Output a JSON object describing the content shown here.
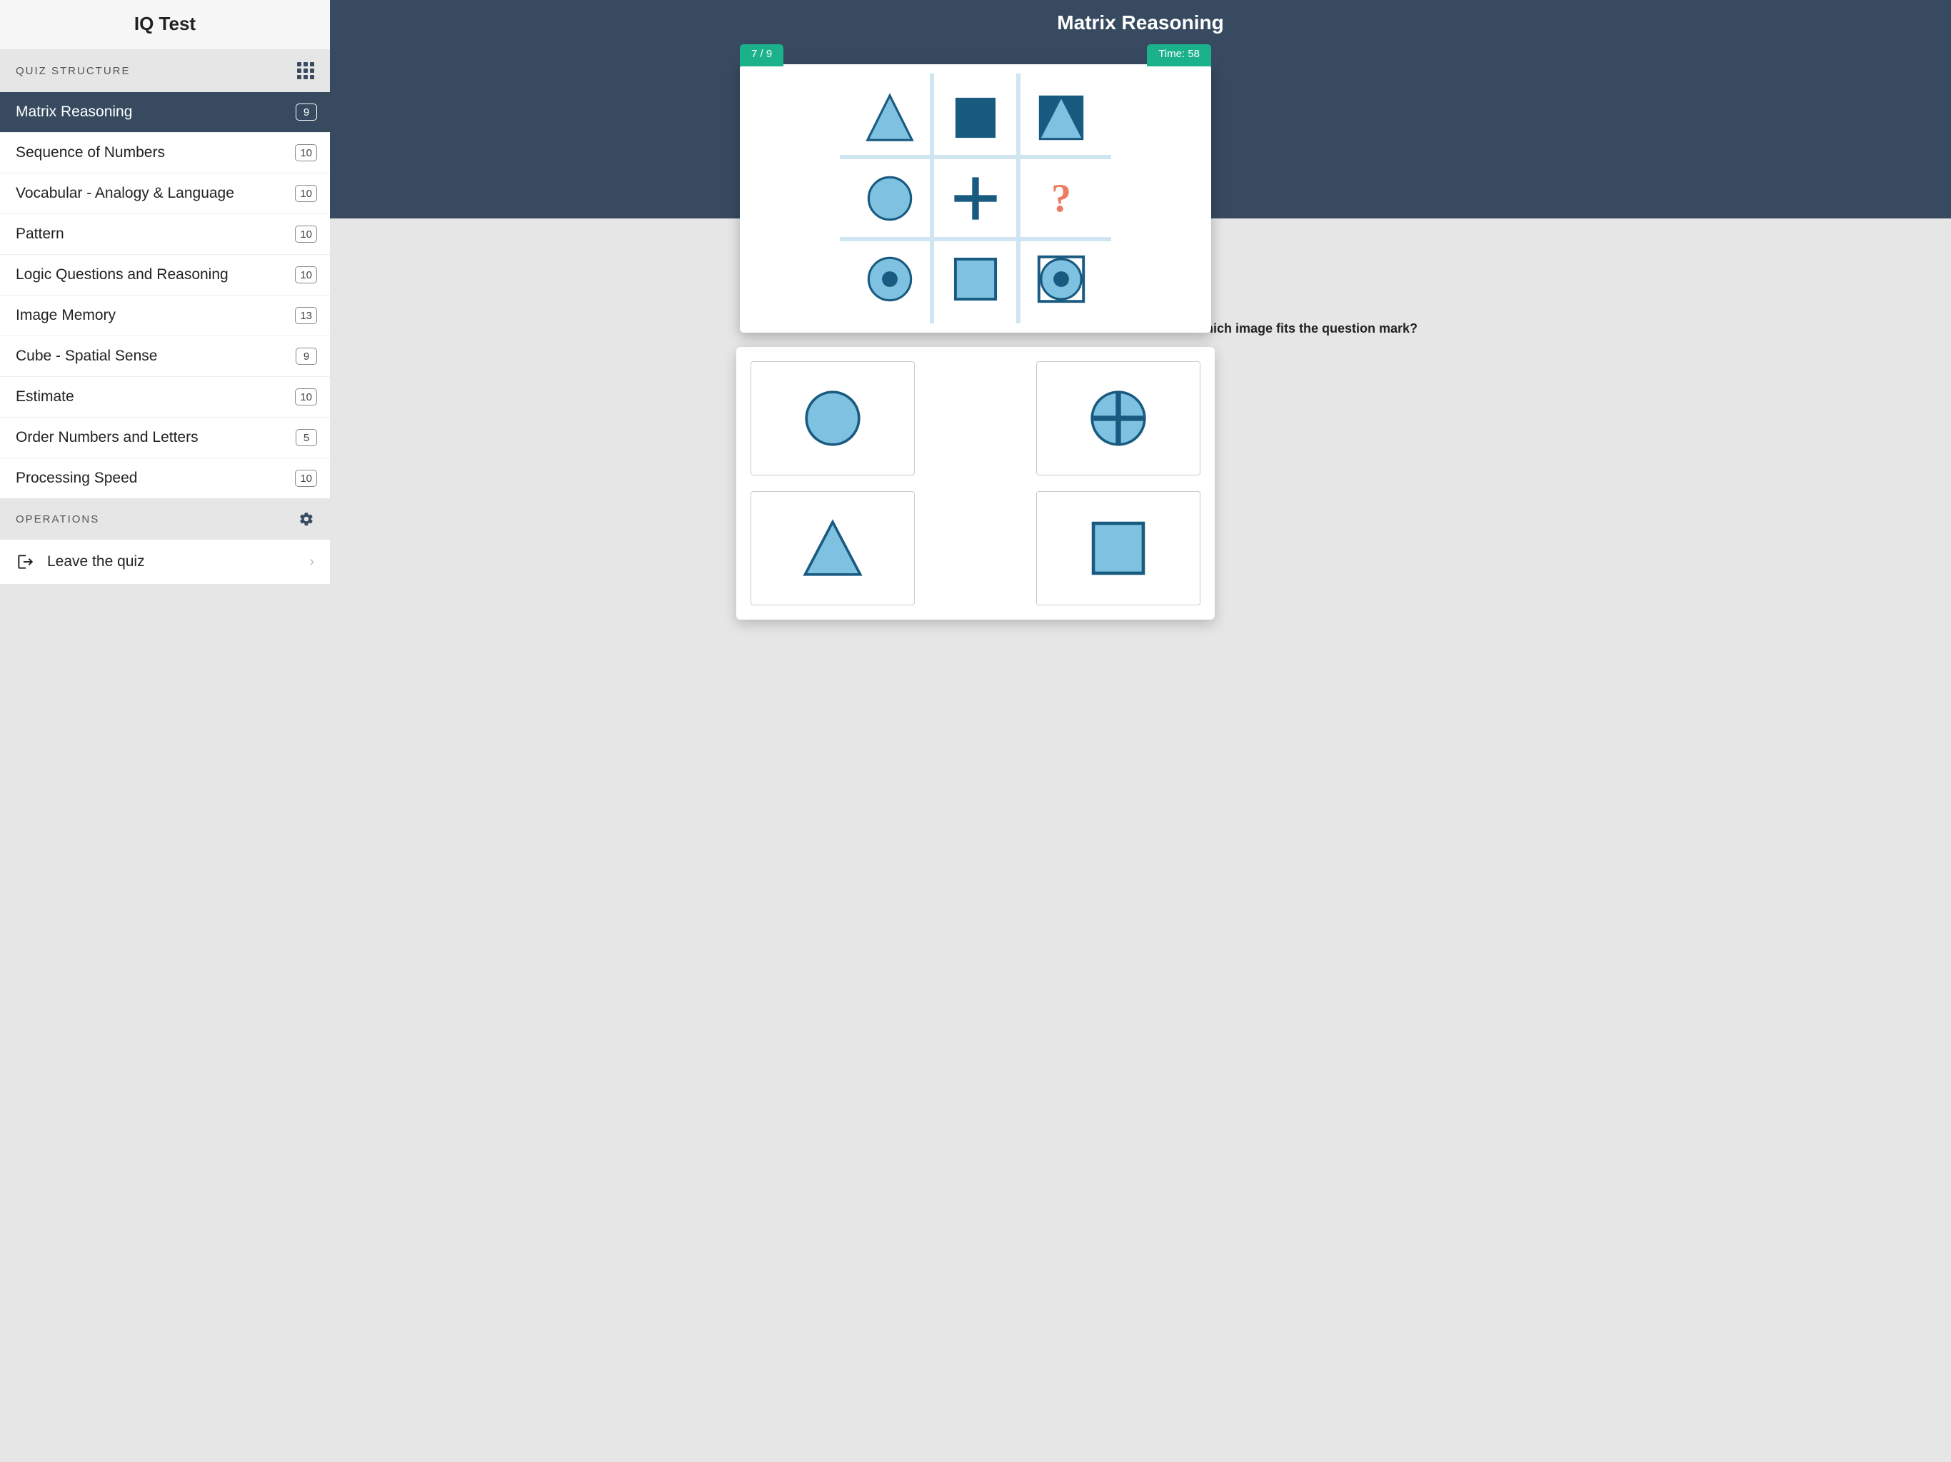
{
  "app_title": "IQ Test",
  "sidebar": {
    "section_quiz_label": "QUIZ STRUCTURE",
    "section_ops_label": "OPERATIONS",
    "items": [
      {
        "label": "Matrix Reasoning",
        "count": "9",
        "active": true
      },
      {
        "label": "Sequence of Numbers",
        "count": "10",
        "active": false
      },
      {
        "label": "Vocabular - Analogy & Language",
        "count": "10",
        "active": false
      },
      {
        "label": "Pattern",
        "count": "10",
        "active": false
      },
      {
        "label": "Logic Questions and Reasoning",
        "count": "10",
        "active": false
      },
      {
        "label": "Image Memory",
        "count": "13",
        "active": false
      },
      {
        "label": "Cube - Spatial Sense",
        "count": "9",
        "active": false
      },
      {
        "label": "Estimate",
        "count": "10",
        "active": false
      },
      {
        "label": "Order Numbers and Letters",
        "count": "5",
        "active": false
      },
      {
        "label": "Processing Speed",
        "count": "10",
        "active": false
      }
    ],
    "ops": [
      {
        "label": "Leave the quiz"
      }
    ]
  },
  "main": {
    "title": "Matrix Reasoning",
    "progress_label": "7 / 9",
    "time_label": "Time: 58",
    "question_prompt": "Which image fits the question mark?",
    "matrix": {
      "cells": [
        "triangle-light",
        "square-dark",
        "triangle-dark-square",
        "circle-light",
        "plus-dark",
        "question",
        "circle-dot",
        "square-outline-light",
        "square-circle-dot"
      ]
    },
    "answers": [
      "circle-light",
      "circle-cross",
      "triangle-light",
      "square-outline-light"
    ]
  },
  "colors": {
    "light_fill": "#7fc1e0",
    "dark_fill": "#195a80",
    "accent_green": "#1bb18b",
    "header_bg": "#374a60",
    "qmark": "#ee7b64"
  }
}
